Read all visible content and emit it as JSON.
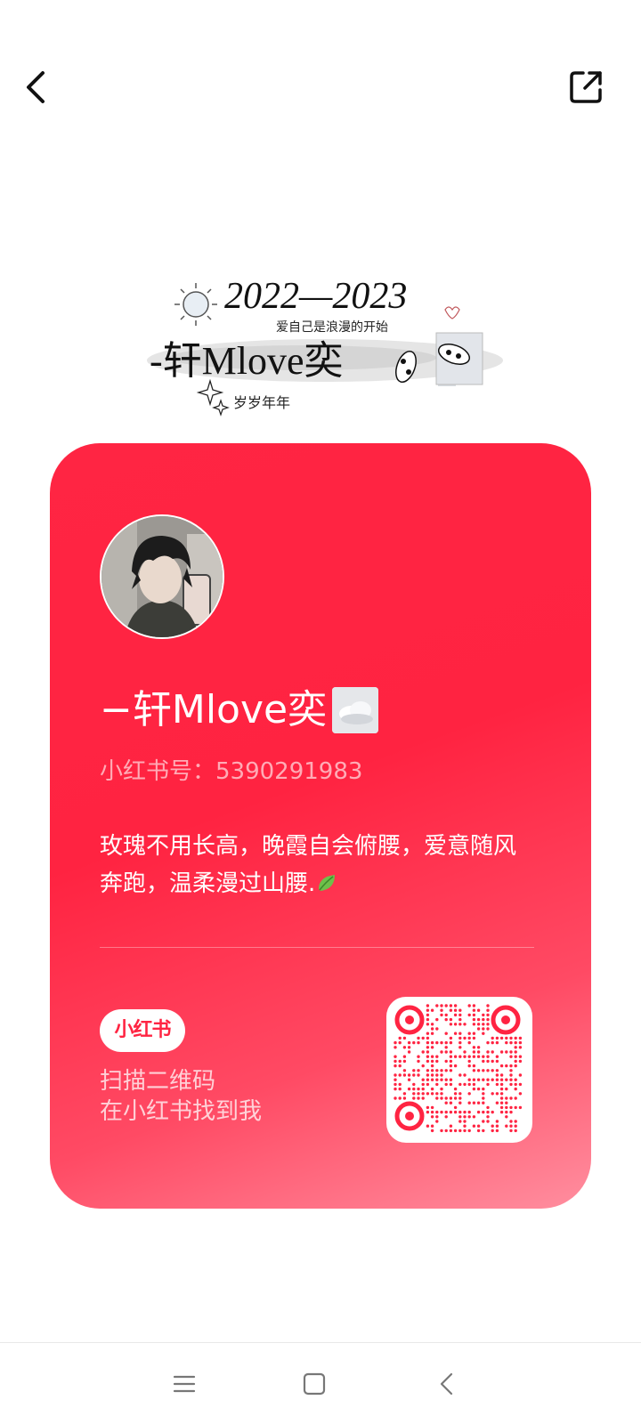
{
  "banner": {
    "year_text": "2022—2023",
    "subtitle": "爱自己是浪漫的开始",
    "name_text": "-轩Mlove奕",
    "footer_text": "岁岁年年"
  },
  "profile": {
    "nickname": "−轩Mlove奕",
    "red_id": "小红书号：5390291983",
    "bio": "玫瑰不用长高，晚霞自会俯腰，爱意随风奔跑，温柔漫过山腰.",
    "avatar_alt": "avatar"
  },
  "promo": {
    "logo_text": "小红书",
    "scan_line1": "扫描二维码",
    "scan_line2": "在小红书找到我"
  },
  "colors": {
    "brand_red": "#ff2442",
    "card_gradient_end": "#ff8e9f"
  },
  "icons": {
    "back": "chevron-left-icon",
    "share": "share-external-icon",
    "nav_menu": "menu-icon",
    "nav_home": "square-home-icon",
    "nav_back": "nav-back-icon"
  }
}
